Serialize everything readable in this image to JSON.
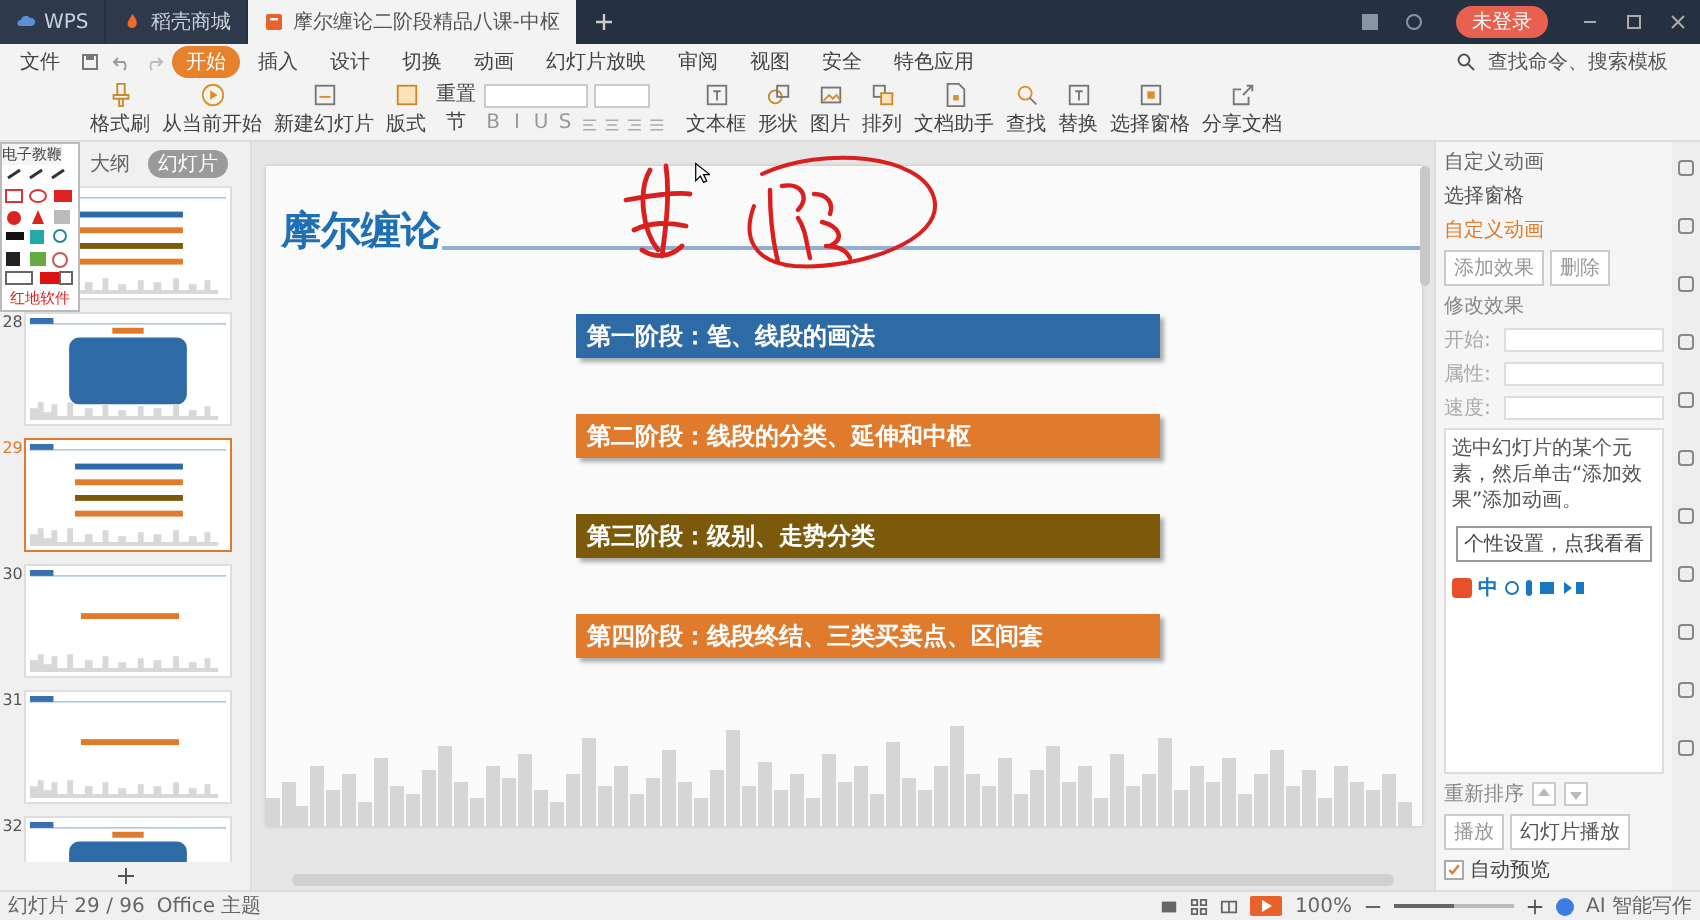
{
  "tabs": [
    {
      "label": "WPS",
      "kind": "home",
      "selected": false
    },
    {
      "label": "稻壳商城",
      "kind": "store",
      "selected": false
    },
    {
      "label": "摩尔缠论二阶段精品八课-中枢",
      "kind": "doc",
      "selected": true
    }
  ],
  "account_badge": "未登录",
  "menu": {
    "file": "文件",
    "tabs": [
      {
        "label": "开始",
        "selected": true
      },
      {
        "label": "插入",
        "selected": false
      },
      {
        "label": "设计",
        "selected": false
      },
      {
        "label": "切换",
        "selected": false
      },
      {
        "label": "动画",
        "selected": false
      },
      {
        "label": "幻灯片放映",
        "selected": false
      },
      {
        "label": "审阅",
        "selected": false
      },
      {
        "label": "视图",
        "selected": false
      },
      {
        "label": "安全",
        "selected": false
      },
      {
        "label": "特色应用",
        "selected": false
      }
    ],
    "search": {
      "placeholder": "查找命令、搜索模板"
    }
  },
  "ribbon_left": [
    {
      "label": "格式刷",
      "kind": "brush"
    },
    {
      "label": "从当前开始",
      "kind": "play"
    },
    {
      "label": "新建幻灯片",
      "kind": "slide"
    },
    {
      "label": "版式",
      "kind": "layout"
    }
  ],
  "ribbon_small": [
    {
      "label": "重置"
    },
    {
      "label": "节"
    }
  ],
  "format_buttons": [
    "B",
    "I",
    "U",
    "S"
  ],
  "ribbon_right": [
    {
      "label": "文本框",
      "kind": "text"
    },
    {
      "label": "形状",
      "kind": "shape"
    },
    {
      "label": "图片",
      "kind": "picture"
    },
    {
      "label": "排列",
      "kind": "layout"
    },
    {
      "label": "文档助手",
      "kind": "doc"
    },
    {
      "label": "查找",
      "kind": "search"
    },
    {
      "label": "替换",
      "kind": "text"
    },
    {
      "label": "选择窗格",
      "kind": "pane"
    },
    {
      "label": "分享文档",
      "kind": "share"
    }
  ],
  "tool_palette": {
    "title": "电子教鞭",
    "footer": "红地软件"
  },
  "panel_tabs": [
    {
      "label": "大纲",
      "selected": false
    },
    {
      "label": "幻灯片",
      "selected": true
    }
  ],
  "thumbnails": [
    {
      "kind": "bars",
      "selected": false
    },
    {
      "number": "28",
      "kind": "panel",
      "selected": false
    },
    {
      "number": "29",
      "kind": "bars",
      "selected": true
    },
    {
      "number": "30",
      "kind": "bar",
      "selected": false
    },
    {
      "number": "31",
      "kind": "bar",
      "selected": false
    },
    {
      "number": "32",
      "kind": "panel",
      "selected": false
    }
  ],
  "slide": {
    "title": "摩尔缠论",
    "stages": [
      {
        "label": "第一阶段：笔、线段的画法",
        "color": "#2e6aa6"
      },
      {
        "label": "第二阶段：线段的分类、延伸和中枢",
        "color": "#e07a2c"
      },
      {
        "label": "第三阶段：级别、走势分类",
        "color": "#7b5a0c"
      },
      {
        "label": "第四阶段：线段终结、三类买卖点、区间套",
        "color": "#e07a2c"
      }
    ]
  },
  "animation_panel": {
    "title": "自定义动画",
    "pane_link": "选择窗格",
    "section": "自定义动画",
    "add": "添加效果",
    "delete": "删除",
    "modify": "修改效果",
    "fields": [
      "开始:",
      "属性:",
      "速度:"
    ],
    "hint": "选中幻灯片的某个元素，然后单击“添加效果”添加动画。",
    "tooltip": "个性设置，点我看看",
    "ime": "中",
    "reorder": "重新排序",
    "play": "播放",
    "slideshow": "幻灯片播放",
    "autopreview": {
      "label": "自动预览",
      "checked": true
    }
  },
  "status_bar": {
    "slide": "幻灯片 29 / 96",
    "theme": "Office 主题",
    "zoom": {
      "label": "100%",
      "level": 0.5
    },
    "ai": "AI 智能写作"
  }
}
